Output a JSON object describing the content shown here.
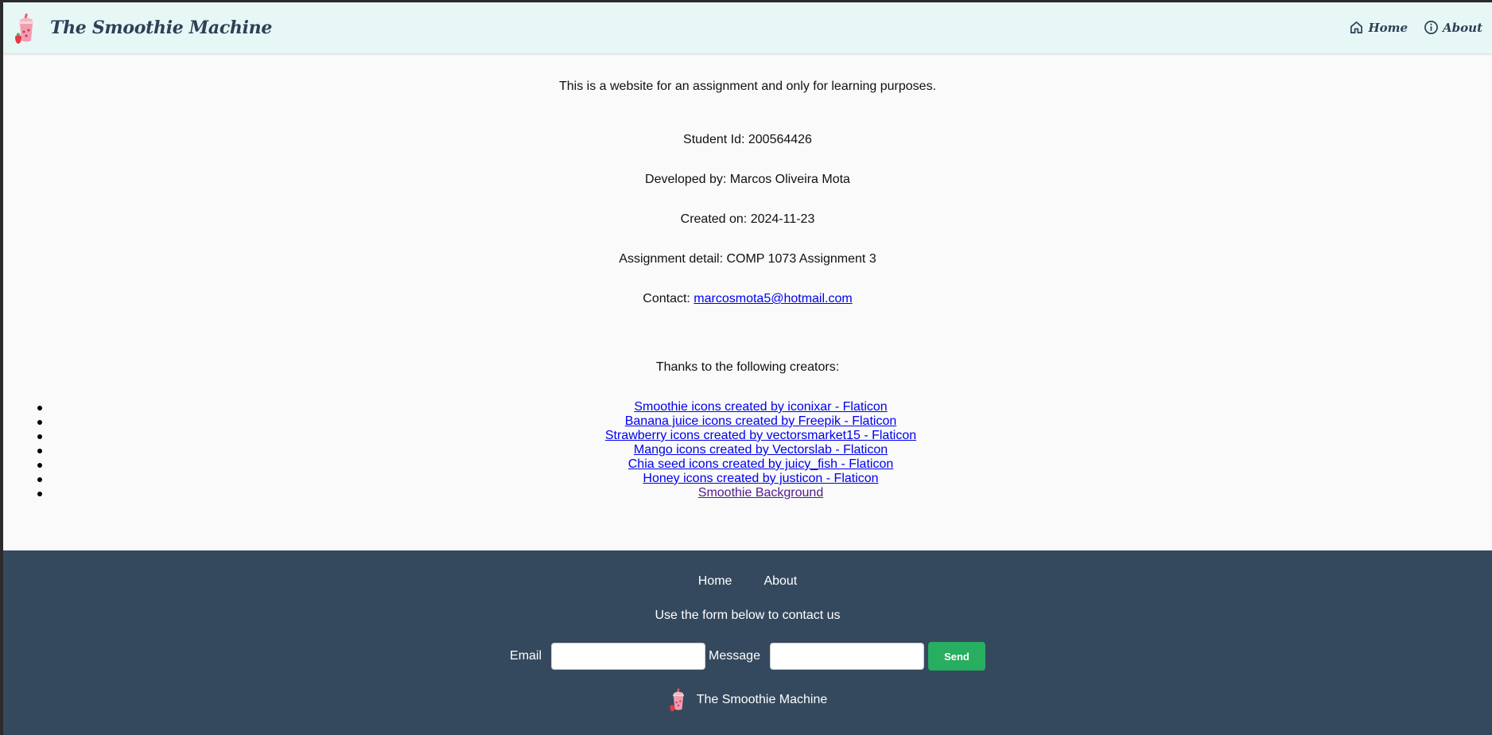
{
  "header": {
    "brand": "The Smoothie Machine",
    "nav": {
      "home": "Home",
      "about": "About"
    }
  },
  "main": {
    "disclaimer": "This is a website for an assignment and only for learning purposes.",
    "student_id": "Student Id: 200564426",
    "developer": "Developed by: Marcos Oliveira Mota",
    "created_on": "Created on: 2024-11-23",
    "assignment": "Assignment detail: COMP 1073 Assignment 3",
    "contact_label": "Contact: ",
    "contact_email": "marcosmota5@hotmail.com",
    "thanks": "Thanks to the following creators:",
    "credits": [
      "Smoothie icons created by iconixar - Flaticon",
      "Banana juice icons created by Freepik - Flaticon",
      "Strawberry icons created by vectorsmarket15 - Flaticon",
      "Mango icons created by Vectorslab - Flaticon",
      "Chia seed icons created by juicy_fish - Flaticon",
      "Honey icons created by justicon - Flaticon",
      "Smoothie Background"
    ]
  },
  "footer": {
    "nav": {
      "home": "Home",
      "about": "About"
    },
    "caption": "Use the form below to contact us",
    "email_label": "Email",
    "email_value": "",
    "message_label": "Message",
    "message_value": "",
    "send_label": "Send",
    "brand": "The Smoothie Machine"
  },
  "colors": {
    "header_bg": "#e6f7f5",
    "brand_text": "#2e4057",
    "footer_bg": "#34495e",
    "send_button": "#27ae60",
    "link": "#0000ee",
    "visited_link": "#551a8b"
  },
  "icons": {
    "logo": "smoothie-cup-icon",
    "home": "home-icon",
    "about": "info-icon"
  }
}
